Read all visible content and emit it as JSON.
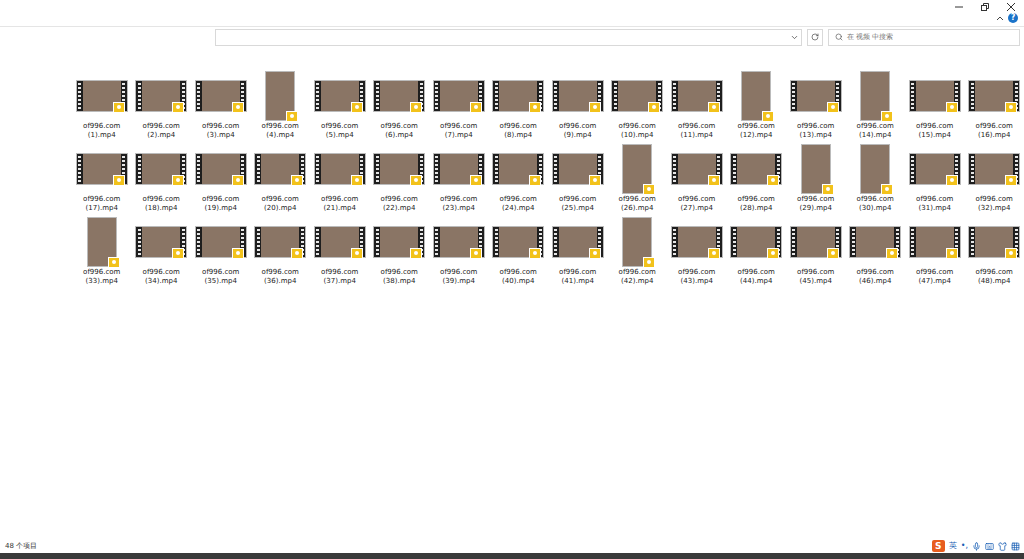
{
  "help": {
    "label": "?"
  },
  "search": {
    "placeholder": "在 视频 中搜索"
  },
  "files": [
    {
      "name": "of996.com (1).mp4",
      "kind": "landscape"
    },
    {
      "name": "of996.com (2).mp4",
      "kind": "landscape"
    },
    {
      "name": "of996.com (3).mp4",
      "kind": "landscape"
    },
    {
      "name": "of996.com (4).mp4",
      "kind": "portrait"
    },
    {
      "name": "of996.com (5).mp4",
      "kind": "landscape"
    },
    {
      "name": "of996.com (6).mp4",
      "kind": "landscape"
    },
    {
      "name": "of996.com (7).mp4",
      "kind": "landscape"
    },
    {
      "name": "of996.com (8).mp4",
      "kind": "landscape"
    },
    {
      "name": "of996.com (9).mp4",
      "kind": "landscape"
    },
    {
      "name": "of996.com (10).mp4",
      "kind": "landscape"
    },
    {
      "name": "of996.com (11).mp4",
      "kind": "landscape"
    },
    {
      "name": "of996.com (12).mp4",
      "kind": "portrait"
    },
    {
      "name": "of996.com (13).mp4",
      "kind": "landscape"
    },
    {
      "name": "of996.com (14).mp4",
      "kind": "portrait"
    },
    {
      "name": "of996.com (15).mp4",
      "kind": "landscape"
    },
    {
      "name": "of996.com (16).mp4",
      "kind": "landscape"
    },
    {
      "name": "of996.com (17).mp4",
      "kind": "landscape"
    },
    {
      "name": "of996.com (18).mp4",
      "kind": "landscape"
    },
    {
      "name": "of996.com (19).mp4",
      "kind": "landscape"
    },
    {
      "name": "of996.com (20).mp4",
      "kind": "landscape"
    },
    {
      "name": "of996.com (21).mp4",
      "kind": "landscape"
    },
    {
      "name": "of996.com (22).mp4",
      "kind": "landscape"
    },
    {
      "name": "of996.com (23).mp4",
      "kind": "landscape"
    },
    {
      "name": "of996.com (24).mp4",
      "kind": "landscape"
    },
    {
      "name": "of996.com (25).mp4",
      "kind": "landscape"
    },
    {
      "name": "of996.com (26).mp4",
      "kind": "portrait"
    },
    {
      "name": "of996.com (27).mp4",
      "kind": "landscape"
    },
    {
      "name": "of996.com (28).mp4",
      "kind": "landscape"
    },
    {
      "name": "of996.com (29).mp4",
      "kind": "portrait"
    },
    {
      "name": "of996.com (30).mp4",
      "kind": "portrait"
    },
    {
      "name": "of996.com (31).mp4",
      "kind": "landscape"
    },
    {
      "name": "of996.com (32).mp4",
      "kind": "landscape"
    },
    {
      "name": "of996.com (33).mp4",
      "kind": "portrait"
    },
    {
      "name": "of996.com (34).mp4",
      "kind": "landscape"
    },
    {
      "name": "of996.com (35).mp4",
      "kind": "landscape"
    },
    {
      "name": "of996.com (36).mp4",
      "kind": "landscape"
    },
    {
      "name": "of996.com (37).mp4",
      "kind": "landscape"
    },
    {
      "name": "of996.com (38).mp4",
      "kind": "landscape"
    },
    {
      "name": "of996.com (39).mp4",
      "kind": "landscape"
    },
    {
      "name": "of996.com (40).mp4",
      "kind": "landscape"
    },
    {
      "name": "of996.com (41).mp4",
      "kind": "landscape"
    },
    {
      "name": "of996.com (42).mp4",
      "kind": "portrait"
    },
    {
      "name": "of996.com (43).mp4",
      "kind": "landscape"
    },
    {
      "name": "of996.com (44).mp4",
      "kind": "landscape"
    },
    {
      "name": "of996.com (45).mp4",
      "kind": "landscape"
    },
    {
      "name": "of996.com (46).mp4",
      "kind": "landscape"
    },
    {
      "name": "of996.com (47).mp4",
      "kind": "landscape"
    },
    {
      "name": "of996.com (48).mp4",
      "kind": "landscape"
    }
  ],
  "status_bar": {
    "text": "48 个项目"
  },
  "ime": {
    "logo": "S",
    "mode": "英",
    "punct": "•,"
  }
}
